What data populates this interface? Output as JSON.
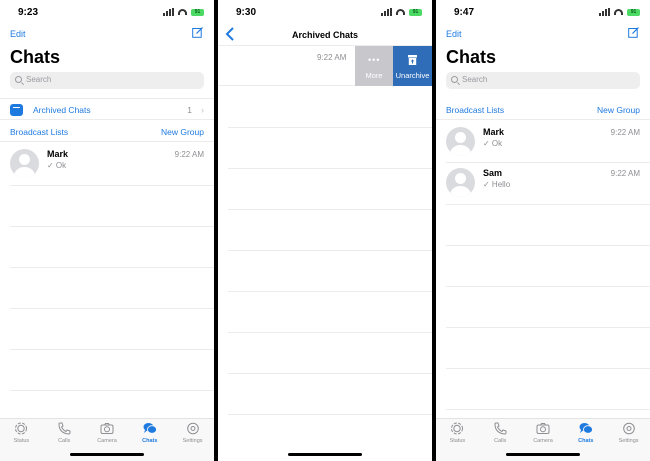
{
  "screen1": {
    "time": "9:23",
    "battery": "91",
    "edit": "Edit",
    "title": "Chats",
    "search_placeholder": "Search",
    "archived_label": "Archived Chats",
    "archived_count": "1",
    "broadcast": "Broadcast Lists",
    "new_group": "New Group",
    "chats": [
      {
        "name": "Mark",
        "time": "9:22 AM",
        "message": "✓ Ok"
      }
    ]
  },
  "screen2": {
    "time": "9:30",
    "battery": "91",
    "title": "Archived Chats",
    "row_time": "9:22 AM",
    "more": "More",
    "unarchive": "Unarchive"
  },
  "screen3": {
    "time": "9:47",
    "battery": "91",
    "edit": "Edit",
    "title": "Chats",
    "search_placeholder": "Search",
    "broadcast": "Broadcast Lists",
    "new_group": "New Group",
    "chats": [
      {
        "name": "Mark",
        "time": "9:22 AM",
        "message": "✓ Ok"
      },
      {
        "name": "Sam",
        "time": "9:22 AM",
        "message": "✓ Hello"
      }
    ]
  },
  "tabs": [
    {
      "label": "Status",
      "icon": "status-icon"
    },
    {
      "label": "Calls",
      "icon": "phone-icon"
    },
    {
      "label": "Camera",
      "icon": "camera-icon"
    },
    {
      "label": "Chats",
      "icon": "chats-icon"
    },
    {
      "label": "Settings",
      "icon": "gear-icon"
    }
  ],
  "colors": {
    "accent": "#1f7ae0",
    "unarchive_bg": "#2f6db8",
    "more_bg": "#c7c7cc",
    "muted_text": "#8e8e93"
  }
}
